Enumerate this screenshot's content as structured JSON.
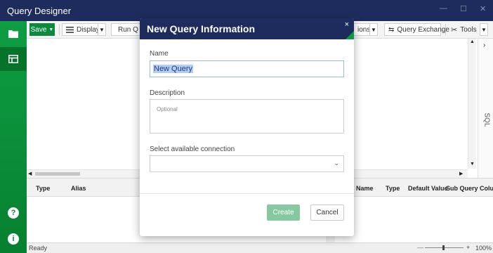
{
  "window": {
    "title": "Query Designer",
    "minimize": "—",
    "maximize": "☐",
    "close": "✕"
  },
  "toolbar": {
    "save_label": "Save",
    "display_label": "Display",
    "run_label": "Run Q",
    "options_label": "ions",
    "query_exchange_label": "Query Exchange",
    "tools_label": "Tools"
  },
  "sql_tab": {
    "label": "SQL"
  },
  "left_grid": {
    "columns": [
      "Type",
      "Alias"
    ]
  },
  "right_grid": {
    "columns": [
      "Name",
      "Type",
      "Default Value",
      "Sub Query Column"
    ]
  },
  "statusbar": {
    "status": "Ready",
    "zoom": "100%",
    "zoom_minus": "—",
    "zoom_plus": "+"
  },
  "dialog": {
    "title": "New Query Information",
    "close": "×",
    "name_label": "Name",
    "name_value": "New Query",
    "description_label": "Description",
    "description_placeholder": "Optional",
    "connection_label": "Select available connection",
    "connection_value": "",
    "create_label": "Create",
    "cancel_label": "Cancel"
  },
  "colors": {
    "title_bar": "#1e2c5d",
    "sidebar_green": "#0a8a3a",
    "accent_green": "#0a9a3f",
    "create_disabled": "#86c9a0",
    "selection": "#b5cdf0"
  },
  "icons": [
    "folder-icon",
    "table-icon",
    "help-icon",
    "info-icon",
    "list-icon",
    "play-icon",
    "exchange-icon",
    "tools-icon",
    "chevron-down-icon",
    "chevron-right-icon",
    "chevron-left-icon",
    "close-icon"
  ]
}
